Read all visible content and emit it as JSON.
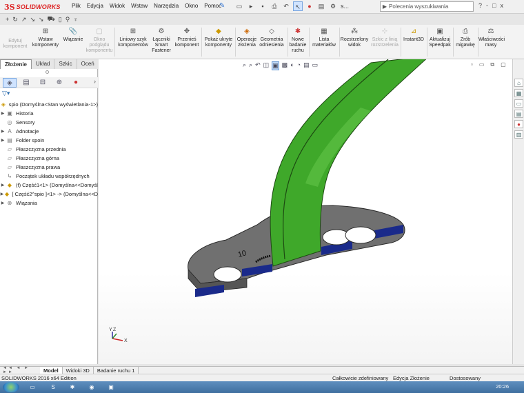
{
  "app": {
    "brand_ds": "3S",
    "brand_name": "SOLIDWORKS"
  },
  "menu": [
    "Plik",
    "Edycja",
    "Widok",
    "Wstaw",
    "Narzędzia",
    "Okno",
    "Pomoc"
  ],
  "quick_access": {
    "s_label": "s..."
  },
  "search": {
    "placeholder": "Polecenia wyszukiwania"
  },
  "help_icons": [
    "?",
    "-",
    "□",
    "x"
  ],
  "ribbon": [
    {
      "label": "Edytuj komponent",
      "icon": "edit-component-icon",
      "enabled": false
    },
    {
      "label": "Wstaw komponenty",
      "icon": "insert-components-icon",
      "enabled": true
    },
    {
      "label": "Wiązanie",
      "icon": "mate-icon",
      "enabled": true
    },
    {
      "label": "Okno podglądu komponentu",
      "icon": "preview-window-icon",
      "enabled": false
    },
    {
      "label": "Liniowy szyk komponentów",
      "icon": "linear-pattern-icon",
      "enabled": true
    },
    {
      "label": "Łączniki Smart Fastener",
      "icon": "smart-fastener-icon",
      "enabled": true
    },
    {
      "label": "Przenieś komponent",
      "icon": "move-component-icon",
      "enabled": true
    },
    {
      "label": "Pokaż ukryte komponenty",
      "icon": "show-hidden-icon",
      "enabled": true
    },
    {
      "label": "Operacje złożenia",
      "icon": "assembly-features-icon",
      "enabled": true
    },
    {
      "label": "Geometria odniesienia",
      "icon": "reference-geometry-icon",
      "enabled": true
    },
    {
      "label": "Nowe badanie ruchu",
      "icon": "new-motion-study-icon",
      "enabled": true
    },
    {
      "label": "Lista materiałów",
      "icon": "bom-icon",
      "enabled": true
    },
    {
      "label": "Rozstrzelony widok",
      "icon": "exploded-view-icon",
      "enabled": true
    },
    {
      "label": "Szkic z linią rozstrzelenia",
      "icon": "explode-line-sketch-icon",
      "enabled": false
    },
    {
      "label": "Instant3D",
      "icon": "instant3d-icon",
      "enabled": true
    },
    {
      "label": "Aktualizuj Speedpak",
      "icon": "speedpak-icon",
      "enabled": true
    },
    {
      "label": "Zrób migawkę",
      "icon": "snapshot-icon",
      "enabled": true
    },
    {
      "label": "Właściwości masy",
      "icon": "mass-properties-icon",
      "enabled": true
    }
  ],
  "panel_tabs": [
    "Złożenie",
    "Układ",
    "Szkic",
    "Oceń"
  ],
  "tree": [
    {
      "label": "spio  (Domyślna<Stan wyświetlania-1>)",
      "icon": "assembly-icon",
      "expandable": false,
      "indent": 0
    },
    {
      "label": "Historia",
      "icon": "history-icon",
      "expandable": true,
      "indent": 1
    },
    {
      "label": "Sensory",
      "icon": "sensors-icon",
      "expandable": false,
      "indent": 1
    },
    {
      "label": "Adnotacje",
      "icon": "annotations-icon",
      "expandable": true,
      "indent": 1
    },
    {
      "label": "Folder spoin",
      "icon": "weld-folder-icon",
      "expandable": true,
      "indent": 1
    },
    {
      "label": "Płaszczyzna przednia",
      "icon": "plane-icon",
      "expandable": false,
      "indent": 1
    },
    {
      "label": "Płaszczyzna górna",
      "icon": "plane-icon",
      "expandable": false,
      "indent": 1
    },
    {
      "label": "Płaszczyzna prawa",
      "icon": "plane-icon",
      "expandable": false,
      "indent": 1
    },
    {
      "label": "Początek układu współrzędnych",
      "icon": "origin-icon",
      "expandable": false,
      "indent": 1
    },
    {
      "label": "(f) Część1<1> (Domyślna<<Domyśl",
      "icon": "part-icon",
      "expandable": true,
      "indent": 1
    },
    {
      "label": "[ Część2^spio ]<1> -> (Domyślna<<D",
      "icon": "part-icon",
      "expandable": true,
      "indent": 1
    },
    {
      "label": "Wiązania",
      "icon": "mates-icon",
      "expandable": true,
      "indent": 1
    }
  ],
  "model": {
    "weld_label": "10"
  },
  "triad": {
    "x": "X",
    "y": "Y",
    "z": "Z"
  },
  "bottom_tabs": [
    "Model",
    "Widoki 3D",
    "Badanie ruchu 1"
  ],
  "status": {
    "edition": "SOLIDWORKS 2016 x64 Edition",
    "definition": "Całkowicie zdefiniowany",
    "mode": "Edycja Złożenie",
    "units": "Dostosowany"
  },
  "taskbar": {
    "clock": "20:26"
  },
  "colors": {
    "brand": "#d22222",
    "green_part": "#3fa82a",
    "plate_gray": "#6e6e6e",
    "plate_edge": "#1a2a8a"
  }
}
